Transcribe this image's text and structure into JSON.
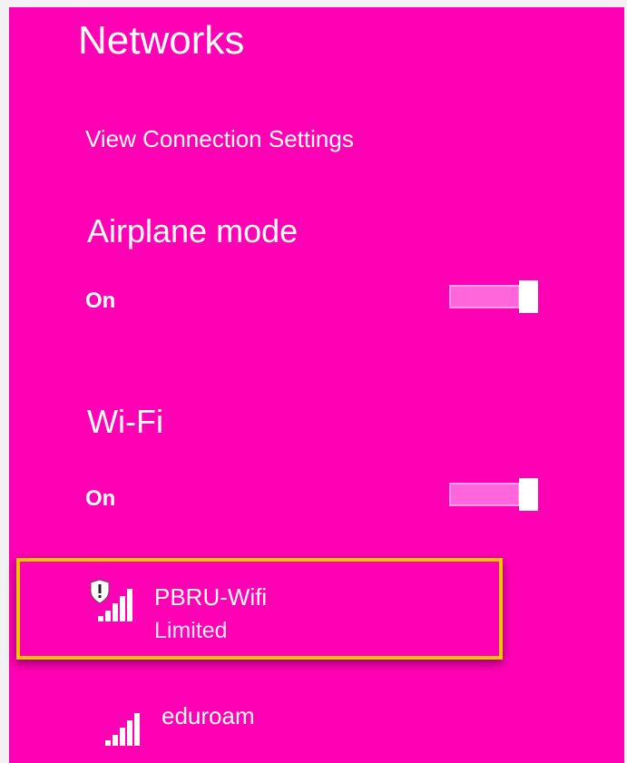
{
  "panel": {
    "title": "Networks",
    "view_settings_link": "View Connection Settings",
    "background_color": "#ff00b4"
  },
  "airplane_mode": {
    "heading": "Airplane mode",
    "toggle_state_label": "On",
    "is_on": true
  },
  "wifi": {
    "heading": "Wi-Fi",
    "toggle_state_label": "On",
    "is_on": true
  },
  "networks": [
    {
      "name": "PBRU-Wifi",
      "status": "Limited",
      "icon": "signal-bars-with-warning-shield-icon",
      "highlighted": true,
      "highlight_color": "#f2c500"
    },
    {
      "name": "eduroam",
      "icon": "signal-bars-icon"
    }
  ]
}
